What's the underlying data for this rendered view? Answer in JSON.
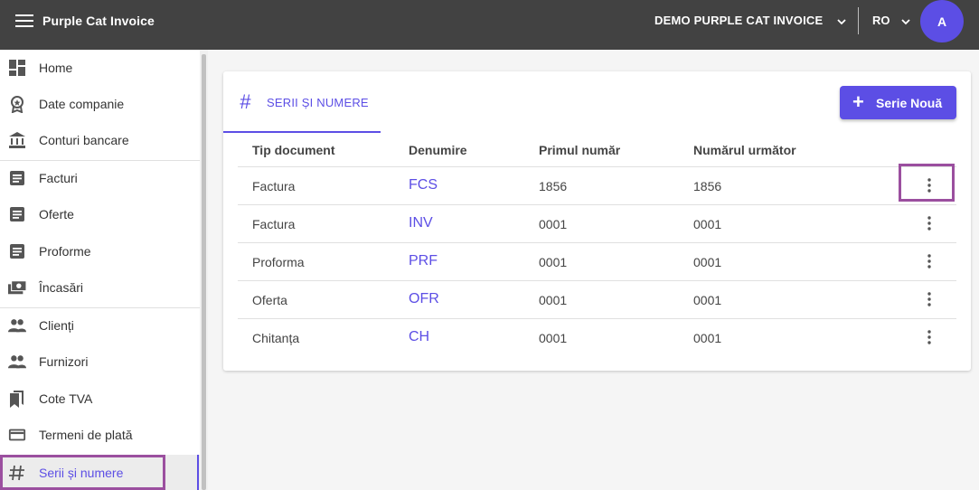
{
  "header": {
    "app_title": "Purple Cat Invoice",
    "company": "DEMO PURPLE CAT INVOICE",
    "language": "RO",
    "avatar_initial": "A"
  },
  "sidebar": {
    "items": [
      {
        "label": "Home",
        "icon": "dashboard-icon"
      },
      {
        "label": "Date companie",
        "icon": "award-icon"
      },
      {
        "label": "Conturi bancare",
        "icon": "bank-icon"
      },
      {
        "label": "Facturi",
        "icon": "document-icon"
      },
      {
        "label": "Oferte",
        "icon": "document-icon"
      },
      {
        "label": "Proforme",
        "icon": "document-icon"
      },
      {
        "label": "Încasări",
        "icon": "cash-icon"
      },
      {
        "label": "Clienți",
        "icon": "people-icon"
      },
      {
        "label": "Furnizori",
        "icon": "people-icon"
      },
      {
        "label": "Cote TVA",
        "icon": "bookmarks-icon"
      },
      {
        "label": "Termeni de plată",
        "icon": "credit-card-icon"
      },
      {
        "label": "Serii și numere",
        "icon": "hash-icon"
      }
    ]
  },
  "main": {
    "tab_label": "SERII ȘI NUMERE",
    "new_button_label": "Serie Nouă",
    "columns": [
      "Tip document",
      "Denumire",
      "Primul număr",
      "Numărul următor"
    ],
    "rows": [
      {
        "tip": "Factura",
        "denumire": "FCS",
        "primul": "1856",
        "urmator": "1856"
      },
      {
        "tip": "Factura",
        "denumire": "INV",
        "primul": "0001",
        "urmator": "0001"
      },
      {
        "tip": "Proforma",
        "denumire": "PRF",
        "primul": "0001",
        "urmator": "0001"
      },
      {
        "tip": "Oferta",
        "denumire": "OFR",
        "primul": "0001",
        "urmator": "0001"
      },
      {
        "tip": "Chitanța",
        "denumire": "CH",
        "primul": "0001",
        "urmator": "0001"
      }
    ]
  },
  "colors": {
    "accent": "#5c4ee5",
    "topbar": "#424242",
    "highlight": "#9b4f9f"
  }
}
